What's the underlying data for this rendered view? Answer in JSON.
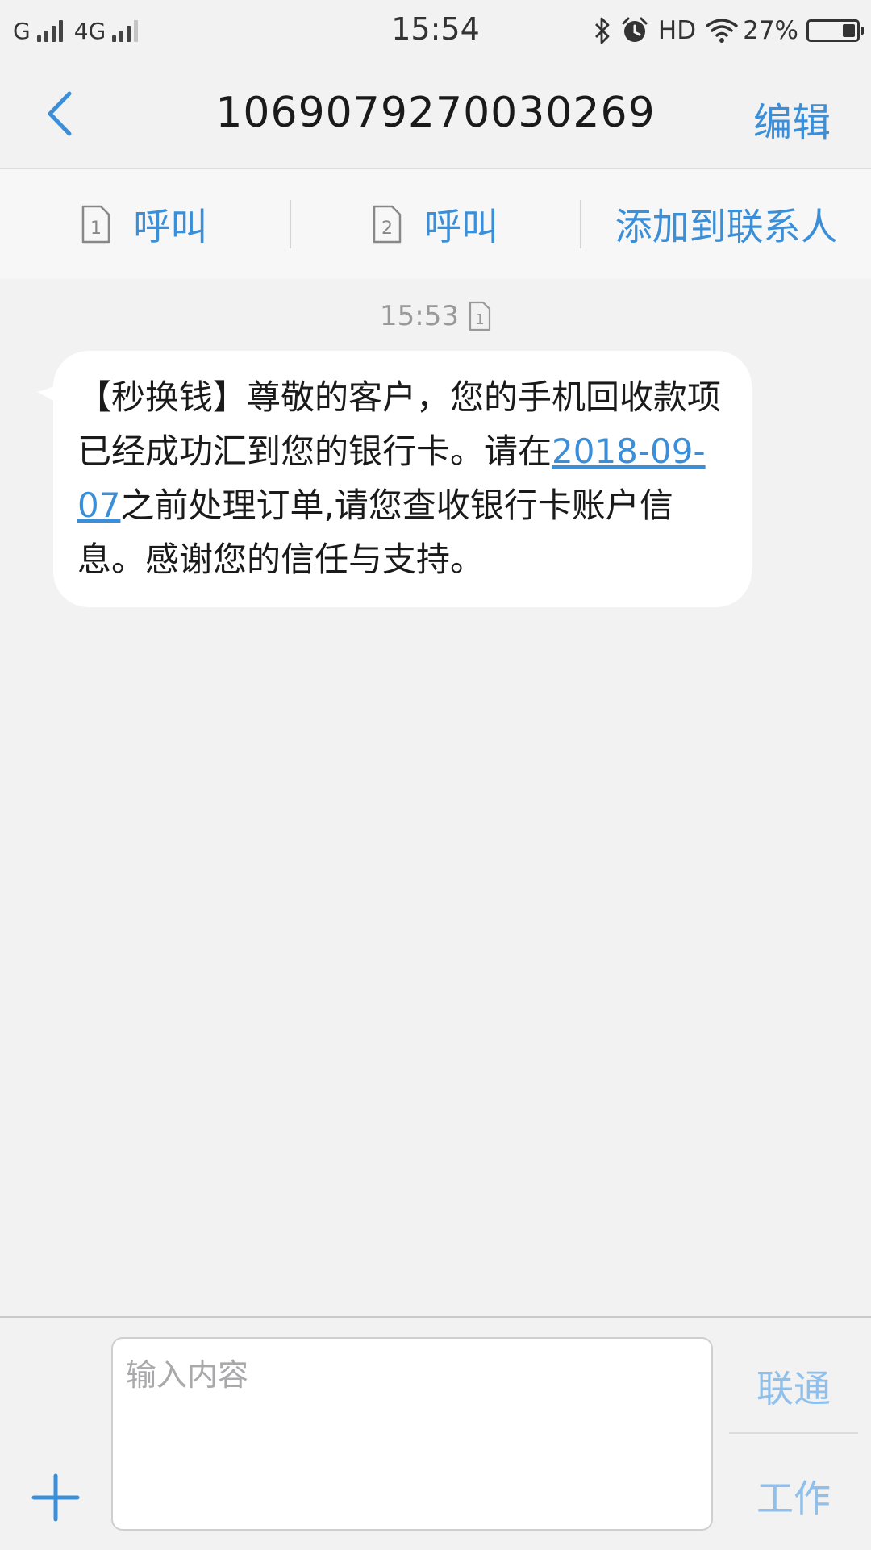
{
  "status_bar": {
    "sim1_label": "G",
    "sim2_label": "4G",
    "time": "15:54",
    "hd_label": "HD",
    "battery": "27%",
    "battery_level": 0.27
  },
  "header": {
    "title": "1069079270030269",
    "edit_label": "编辑"
  },
  "actions": {
    "call1_label": "呼叫",
    "call2_label": "呼叫",
    "add_contact_label": "添加到联系人"
  },
  "message": {
    "time": "15:53",
    "text_before_link": "【秒换钱】尊敬的客户，您的手机回收款项已经成功汇到您的银行卡。请在",
    "link_text": "2018-09-07",
    "text_after_link": "之前处理订单,请您查收银行卡账户信息。感谢您的信任与支持。"
  },
  "compose": {
    "placeholder": "输入内容",
    "send_sim1_label": "联通",
    "send_sim2_label": "工作"
  },
  "colors": {
    "accent": "#3b8fd8",
    "accent_light": "#8fc0eb",
    "background": "#f2f2f3",
    "bubble": "#ffffff"
  }
}
